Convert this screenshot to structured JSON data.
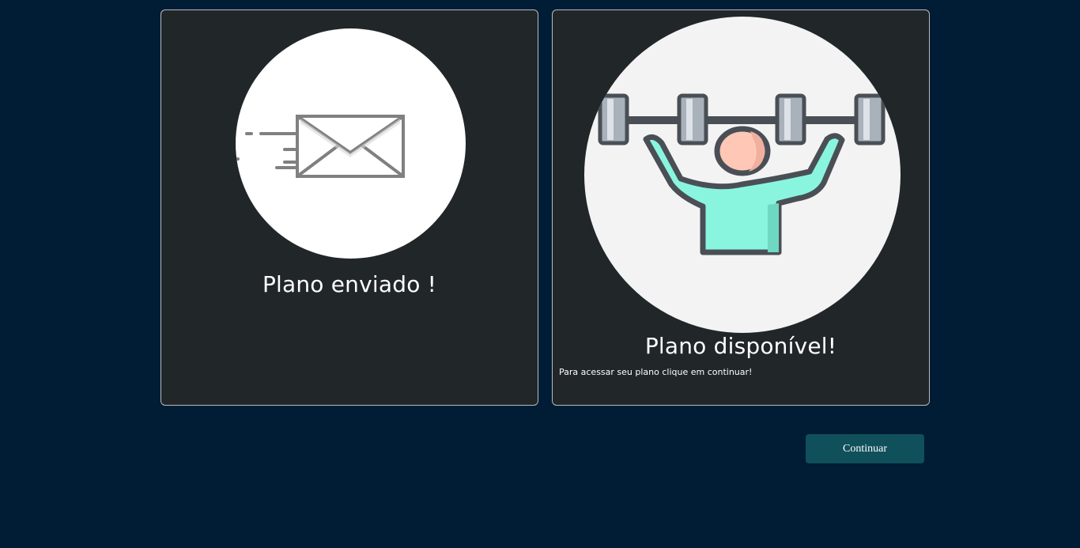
{
  "cards": [
    {
      "title": "Plano enviado !",
      "icon": "envelope-sent-icon"
    },
    {
      "title": "Plano disponível!",
      "description": "Para acessar seu plano clique em continuar!",
      "icon": "weightlifter-icon"
    }
  ],
  "actions": {
    "continue_label": "Continuar"
  },
  "colors": {
    "page_background": "#001d35",
    "card_background": "#212629",
    "card_border": "#b8bcc0",
    "button_background": "#10505a",
    "text": "#ffffff"
  }
}
